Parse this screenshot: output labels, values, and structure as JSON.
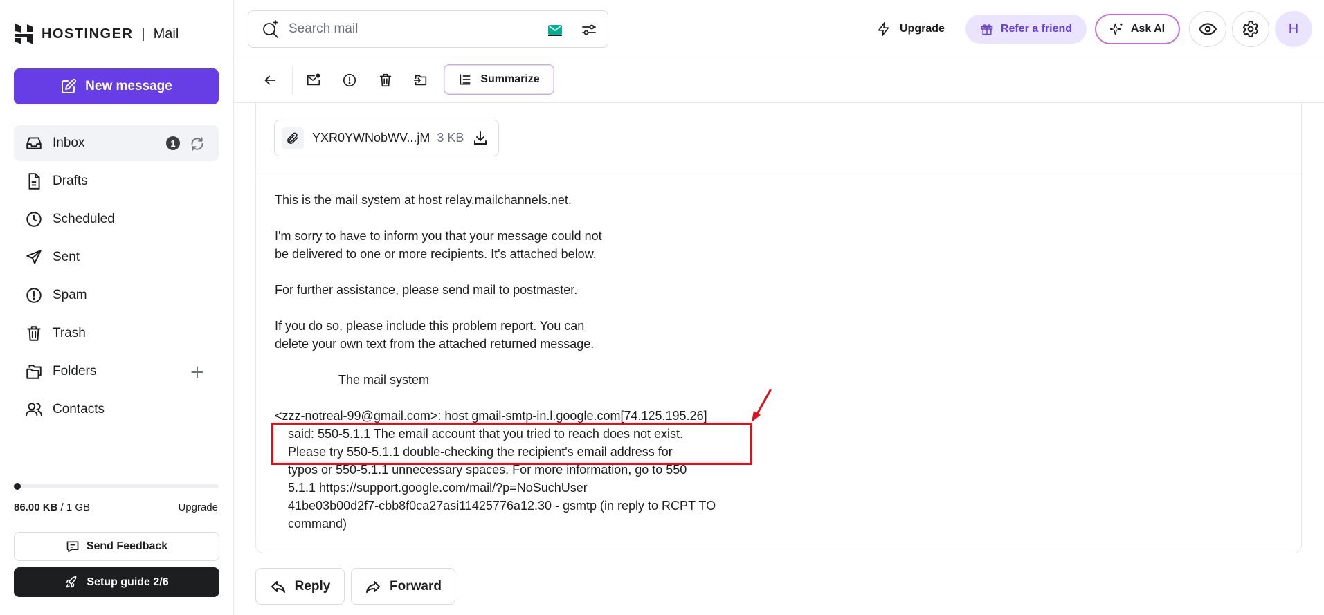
{
  "brand": {
    "name": "HOSTINGER",
    "separator": "|",
    "product": "Mail"
  },
  "sidebar": {
    "new_message": "New message",
    "items": [
      {
        "label": "Inbox",
        "icon": "inbox-icon",
        "badge": "1"
      },
      {
        "label": "Drafts",
        "icon": "draft-icon"
      },
      {
        "label": "Scheduled",
        "icon": "clock-icon"
      },
      {
        "label": "Sent",
        "icon": "send-icon"
      },
      {
        "label": "Spam",
        "icon": "alert-icon"
      },
      {
        "label": "Trash",
        "icon": "trash-icon"
      },
      {
        "label": "Folders",
        "icon": "folders-icon"
      },
      {
        "label": "Contacts",
        "icon": "contacts-icon"
      }
    ],
    "storage": {
      "used": "86.00 KB",
      "total": "/ 1 GB",
      "fill_fraction": 0.0001,
      "upgrade": "Upgrade"
    },
    "feedback": "Send Feedback",
    "setup_guide": "Setup guide 2/6"
  },
  "topbar": {
    "search_placeholder": "Search mail",
    "upgrade": "Upgrade",
    "refer": "Refer a friend",
    "ask_ai": "Ask AI",
    "avatar_initial": "H"
  },
  "toolbar": {
    "summarize": "Summarize"
  },
  "email": {
    "attachment": {
      "name": "YXR0YWNobWV...jM",
      "size": "3 KB"
    },
    "body": {
      "p1": "This is the mail system at host relay.mailchannels.net.",
      "p2_l1": "I'm sorry to have to inform you that your message could not",
      "p2_l2": "be delivered to one or more recipients. It's attached below.",
      "p3": "For further assistance, please send mail to postmaster.",
      "p4_l1": "If you do so, please include this problem report. You can",
      "p4_l2": "delete your own text from the attached returned message.",
      "signature": "The mail system",
      "err_l1": "<zzz-notreal-99@gmail.com>: host gmail-smtp-in.l.google.com[74.125.195.26]",
      "err_l2": "said: 550-5.1.1 The email account that you tried to reach does not exist.",
      "err_l3": "Please try 550-5.1.1 double-checking the recipient's email address for",
      "err_l4": "typos or 550-5.1.1 unnecessary spaces. For more information, go to 550",
      "err_l5": "5.1.1  https://support.google.com/mail/?p=NoSuchUser",
      "err_l6": "41be03b00d2f7-cbb8f0ca27asi11425776a12.30 - gsmtp (in reply to RCPT TO",
      "err_l7": "command)"
    }
  },
  "actions": {
    "reply": "Reply",
    "forward": "Forward"
  },
  "colors": {
    "brand_purple": "#673de6",
    "highlight_red": "#e0101b",
    "dark": "#1d1e20"
  }
}
